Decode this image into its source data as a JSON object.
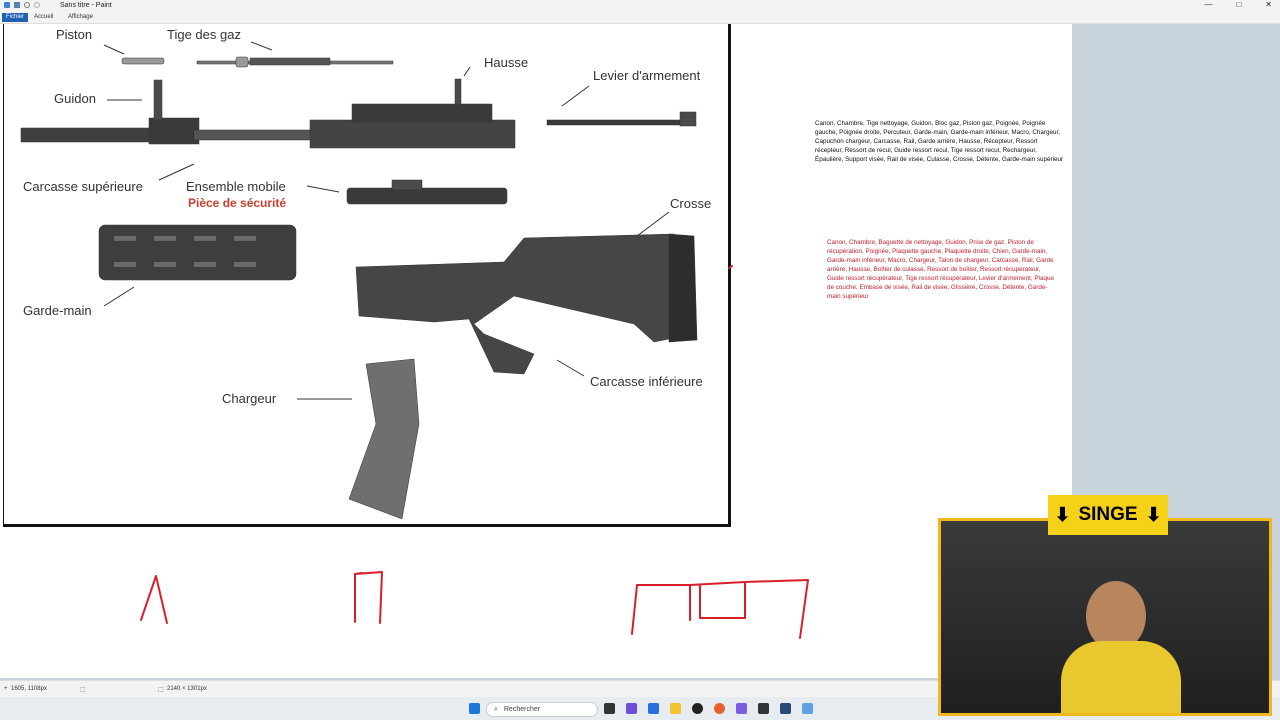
{
  "window": {
    "title": "Sans titre - Paint",
    "tabs": [
      "Fichier",
      "Accueil",
      "Affichage"
    ],
    "controls": [
      "—",
      "□",
      "✕"
    ]
  },
  "diagram": {
    "labels": {
      "piston": "Piston",
      "tige_gaz": "Tige des gaz",
      "hausse": "Hausse",
      "levier": "Levier d'armement",
      "guidon": "Guidon",
      "carcasse_sup": "Carcasse supérieure",
      "ensemble": "Ensemble mobile",
      "securite": "Pièce de sécurité",
      "crosse": "Crosse",
      "garde_main": "Garde-main",
      "carcasse_inf": "Carcasse inférieure",
      "chargeur": "Chargeur"
    }
  },
  "notes": {
    "black_text": "Canon, Chambre, Tige nettoyage, Guidon, Bloc gaz, Piston gaz, Poignée, Poignée gauche, Poignée droite, Percuteur, Garde-main, Garde-main inférieur, Macro, Chargeur, Capuchon chargeur, Carcasse, Rail, Garde arrière, Hausse, Récepteur, Ressort récepteur, Ressort de recul, Guide ressort recul, Tige ressort recul, Rechargeur, Épaulière, Support visée, Rail de visée, Culasse, Crosse, Détente, Garde-main supérieur",
    "red_text": "Canon, Chambre, Baguette de nettoyage, Guidon, Prise de gaz, Piston de récupération, Poignée, Plaquette gauche, Plaquette droite, Chien, Garde-main, Garde-main inférieur, Macro, Chargeur, Talon de chargeur, Carcasse, Rail, Garde arrière, Hausse, Boîtier de culasse, Ressort de boîtier, Ressort récupérateur, Guide ressort récupérateur, Tige ressort récupérateur, Levier d'armement, Plaque de couche, Embase de visée, Rail de visée, Glissière, Crosse, Détente, Garde-main supérieur"
  },
  "status": {
    "cursor_pos": "1605, 1108px",
    "canvas_size": "2140 × 1301px"
  },
  "taskbar": {
    "search_placeholder": "Rechercher"
  },
  "overlay": {
    "banner_text": "SINGE"
  },
  "colors": {
    "accent_blue": "#1e5fb4",
    "drawing_red": "#d8202c",
    "label_red": "#c8402e",
    "banner_yellow": "#f5d118"
  }
}
